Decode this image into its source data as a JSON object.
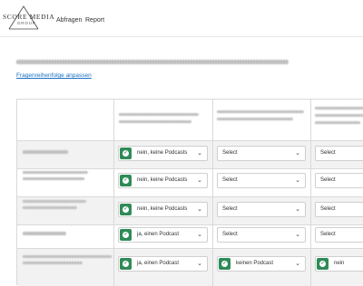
{
  "brand": {
    "name": "SCORE MEDIA",
    "sub": "GROUP"
  },
  "nav": {
    "abfragen": "Abfragen",
    "report": "Report"
  },
  "link": "Fragenreihenfolge anpassen",
  "rows": [
    {
      "c1": "nein, keine Podcasts",
      "c1_checked": true,
      "c2": "Select",
      "c2_checked": false,
      "c3": "Select",
      "c3_checked": false
    },
    {
      "c1": "nein, keine Podcasts",
      "c1_checked": true,
      "c2": "Select",
      "c2_checked": false,
      "c3": "Select",
      "c3_checked": false
    },
    {
      "c1": "nein, keine Podcasts",
      "c1_checked": true,
      "c2": "Select",
      "c2_checked": false,
      "c3": "Select",
      "c3_checked": false
    },
    {
      "c1": "ja, einen Podcast",
      "c1_checked": true,
      "c2": "Select",
      "c2_checked": false,
      "c3": "Select",
      "c3_checked": false
    },
    {
      "c1": "ja, einen Podcast",
      "c1_checked": true,
      "c2": "keinen Podcast",
      "c2_checked": true,
      "c3": "nein",
      "c3_checked": true
    }
  ],
  "colors": {
    "accent": "#2f8b57",
    "link": "#1a6fc4"
  }
}
